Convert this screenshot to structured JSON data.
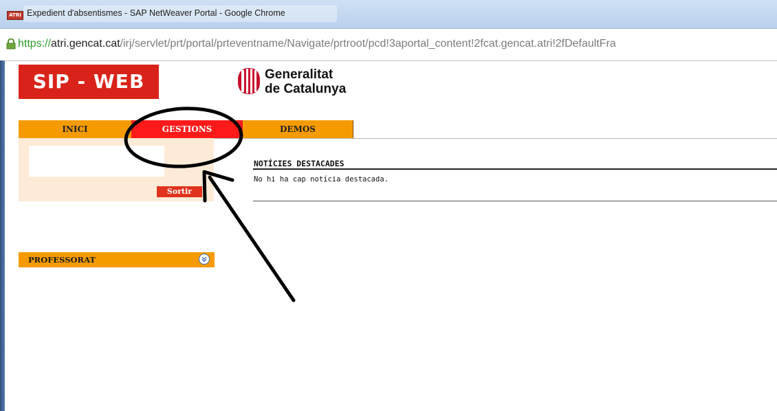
{
  "window": {
    "title": "Expedient d'absentismes - SAP NetWeaver Portal - Google Chrome",
    "app_icon_text": "ATRI"
  },
  "address_bar": {
    "scheme": "https://",
    "host": "atri.gencat.cat",
    "path": "/irj/servlet/prt/portal/prteventname/Navigate/prtroot/pcd!3aportal_content!2fcat.gencat.atri!2fDefaultFra"
  },
  "header": {
    "app_logo": "SIP - WEB",
    "gov_logo_line1": "Generalitat",
    "gov_logo_line2": "de Catalunya"
  },
  "tabs": [
    {
      "label": "INICI"
    },
    {
      "label": "GESTIONS"
    },
    {
      "label": "DEMOS"
    }
  ],
  "login": {
    "input_value": "",
    "logout_label": "Sortir"
  },
  "sidebar": {
    "panel_label": "PROFESSORAT"
  },
  "news": {
    "title": "NOTÍCIES DESTACADES",
    "empty_message": "No hi ha cap notícia destacada."
  },
  "colors": {
    "tab_orange": "#f59b00",
    "tab_active_red": "#ff1a1a",
    "logo_red": "#d9231a",
    "login_panel_bg": "#fdebd7"
  },
  "annotation": {
    "type": "hand-drawn circle and arrow pointing at GESTIONS tab"
  }
}
